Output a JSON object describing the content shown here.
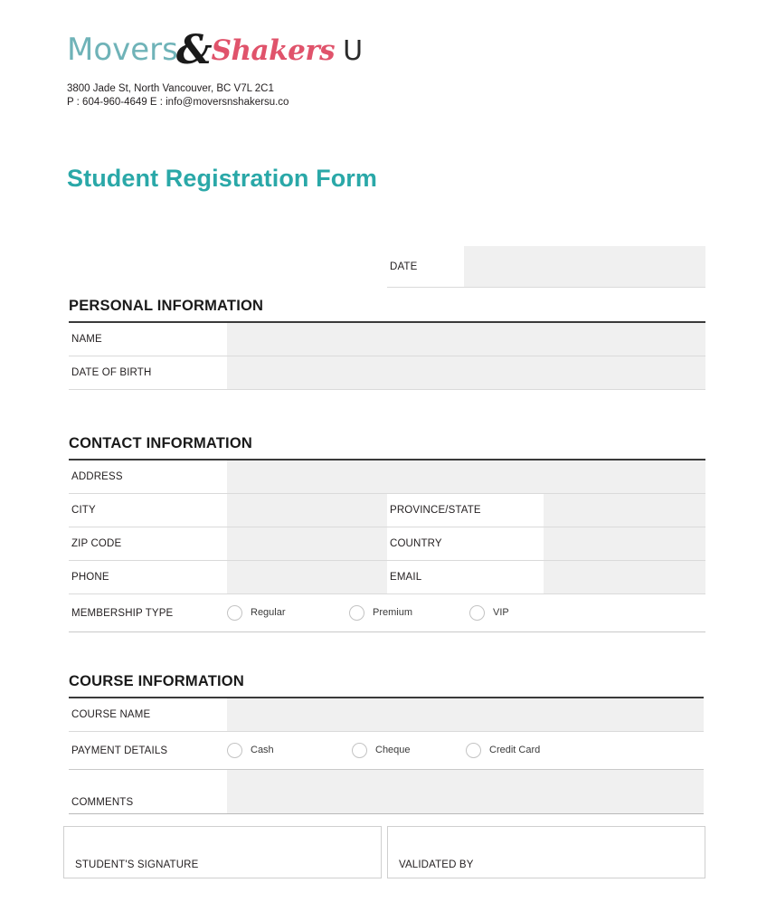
{
  "company": {
    "logo_part1": "Movers",
    "logo_ampersand": "&",
    "logo_part2": "Shakers",
    "logo_part3": "U",
    "address_line1": "3800 Jade St, North Vancouver, BC V7L 2C1",
    "address_line2": "P : 604-960-4649  E : info@moversnshakersu.co",
    "brand_colors": {
      "movers_teal": "#6fb3b8",
      "shakers_pink": "#e0536b",
      "title_teal": "#2aa8a8",
      "field_gray": "#f0f0f0"
    }
  },
  "title": "Student Registration Form",
  "date_row": {
    "label": "DATE",
    "value": ""
  },
  "personal": {
    "heading": "PERSONAL INFORMATION",
    "rows": [
      {
        "label": "NAME",
        "value": ""
      },
      {
        "label": "DATE OF BIRTH",
        "value": ""
      }
    ]
  },
  "contact": {
    "heading": "CONTACT INFORMATION",
    "address_row": {
      "label": "ADDRESS",
      "value": ""
    },
    "paired_rows": [
      {
        "label_left": "CITY",
        "value_left": "",
        "label_right": "PROVINCE/STATE",
        "value_right": ""
      },
      {
        "label_left": "ZIP CODE",
        "value_left": "",
        "label_right": "COUNTRY",
        "value_right": ""
      },
      {
        "label_left": "PHONE",
        "value_left": "",
        "label_right": "EMAIL",
        "value_right": ""
      }
    ],
    "membership": {
      "label": "MEMBERSHIP TYPE",
      "options": [
        {
          "label": "Regular",
          "selected": false
        },
        {
          "label": "Premium",
          "selected": false
        },
        {
          "label": "VIP",
          "selected": false
        }
      ]
    }
  },
  "course": {
    "heading": "COURSE INFORMATION",
    "course_name_row": {
      "label": "COURSE NAME",
      "value": ""
    },
    "payment": {
      "label": "PAYMENT DETAILS",
      "options": [
        {
          "label": "Cash",
          "selected": false
        },
        {
          "label": "Cheque",
          "selected": false
        },
        {
          "label": "Credit Card",
          "selected": false
        }
      ]
    },
    "comments_row": {
      "label": "COMMENTS",
      "value": ""
    }
  },
  "footer": {
    "student_signature_label": "STUDENT'S SIGNATURE",
    "validated_by_label": "VALIDATED BY"
  }
}
